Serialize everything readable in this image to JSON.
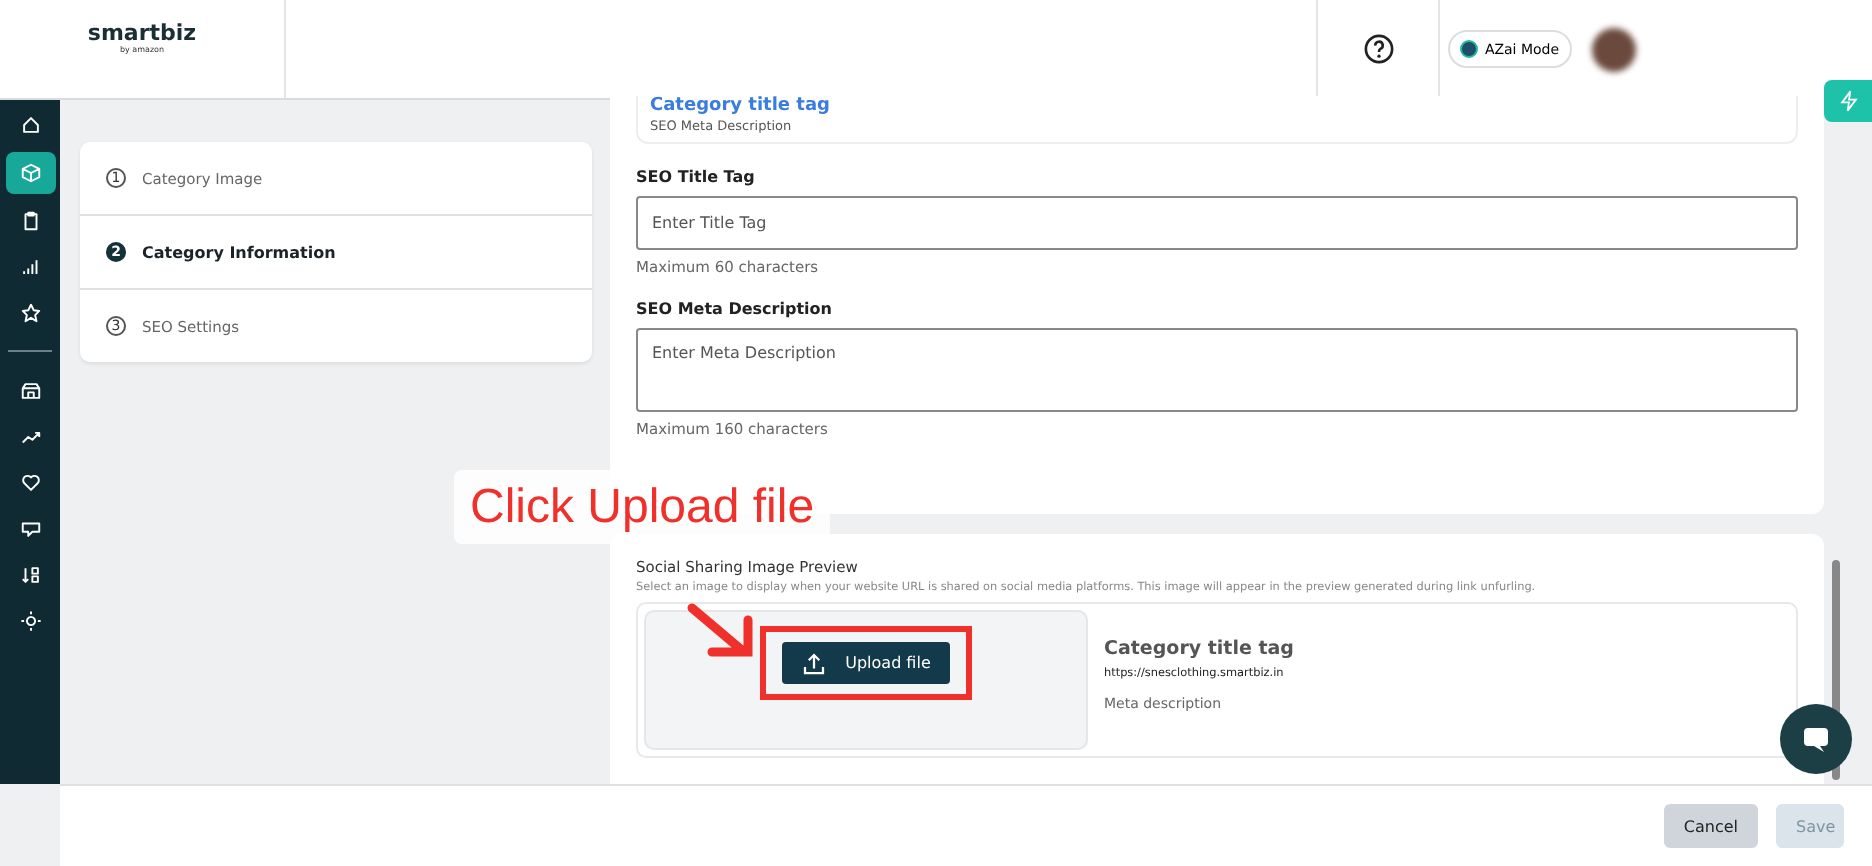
{
  "header": {
    "logo": "smartbiz",
    "logo_tagline": "by amazon",
    "mode_button": "AZai Mode"
  },
  "sidebar": {
    "items": [
      {
        "selected": false
      },
      {
        "selected": true
      },
      {
        "selected": false
      },
      {
        "selected": false
      },
      {
        "selected": false
      },
      {
        "selected": false
      },
      {
        "selected": false
      },
      {
        "selected": false
      },
      {
        "selected": false
      },
      {
        "selected": false
      },
      {
        "selected": false
      }
    ]
  },
  "steps": [
    {
      "number": "1",
      "label": "Category Image",
      "selected": false
    },
    {
      "number": "2",
      "label": "Category Information",
      "selected": true
    },
    {
      "number": "3",
      "label": "SEO Settings",
      "selected": false
    }
  ],
  "seo_preview": {
    "title": "Category title tag",
    "description": "SEO Meta Description"
  },
  "fields": [
    {
      "kind": "input",
      "label": "SEO Title Tag",
      "placeholder": "Enter Title Tag",
      "hint": "Maximum 60 characters"
    },
    {
      "kind": "textarea",
      "label": "SEO Meta Description",
      "placeholder": "Enter Meta Description",
      "hint": "Maximum 160 characters"
    }
  ],
  "social": {
    "heading": "Social Sharing Image Preview",
    "description": "Select an image to display when your website URL is shared on social media platforms. This image will appear in the preview generated during link unfurling.",
    "upload_button": "Upload file",
    "preview": {
      "title": "Category title tag",
      "url": "https://snesclothing.smartbiz.in",
      "description": "Meta description"
    }
  },
  "footer": {
    "buttons": [
      {
        "label": "Cancel",
        "disabled": false
      },
      {
        "label": "Save",
        "disabled": true
      }
    ]
  },
  "annotation": {
    "text": "Click Upload file"
  }
}
